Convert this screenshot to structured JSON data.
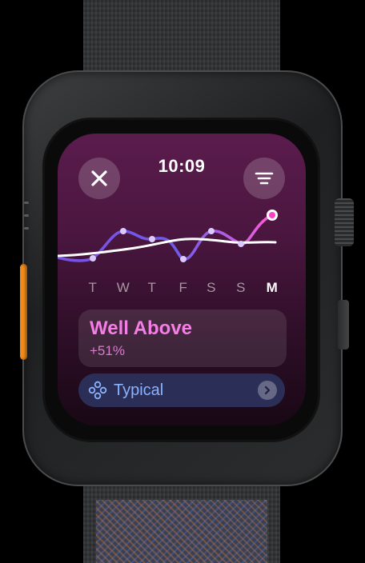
{
  "status": {
    "time": "10:09"
  },
  "header": {
    "close_icon": "xmark-icon",
    "filter_icon": "filter-lines-icon"
  },
  "trend": {
    "days": [
      "T",
      "W",
      "T",
      "F",
      "S",
      "S",
      "M"
    ],
    "current_day_index": 6,
    "colors": {
      "line": "#7a4de6",
      "highlight": "#ff5bd6",
      "typical": "#ffffff"
    }
  },
  "summary": {
    "title": "Well Above",
    "change": "+51%",
    "accent": "#f57de6"
  },
  "typical_row": {
    "label": "Typical",
    "icon": "typical-range-icon",
    "chevron": "chevron-right-icon",
    "accent": "#8ab2ff"
  }
}
